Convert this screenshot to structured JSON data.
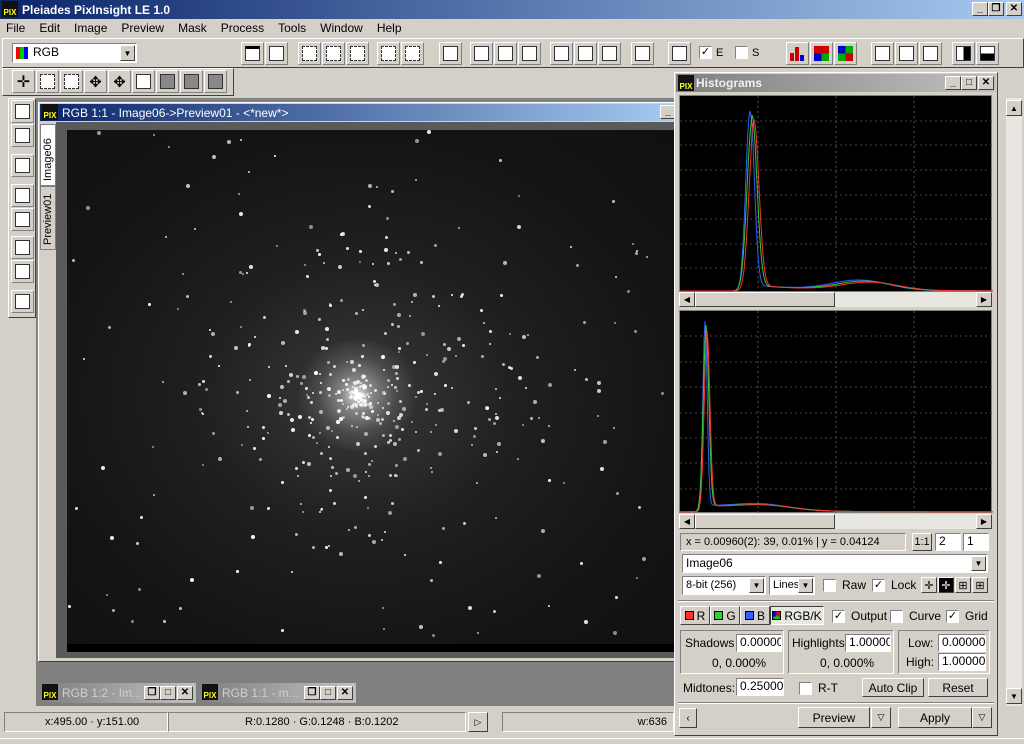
{
  "app": {
    "title": "Pleiades PixInsight LE 1.0",
    "logo_text": "PIX"
  },
  "menu": [
    "File",
    "Edit",
    "Image",
    "Preview",
    "Mask",
    "Process",
    "Tools",
    "Window",
    "Help"
  ],
  "toolbar": {
    "colorspace": "RGB",
    "check_e_label": "E",
    "check_s_label": "S"
  },
  "image_window": {
    "title": "RGB 1:1 - Image06->Preview01 - <*new*>",
    "tabs": [
      "Image06",
      "Preview01"
    ]
  },
  "minimized": [
    {
      "label": "RGB 1:2 - Im..."
    },
    {
      "label": "RGB 1:1 - m..."
    }
  ],
  "histograms": {
    "title": "Histograms",
    "readout": "x = 0.00960(2): 39, 0.01% | y = 0.04124",
    "zoom_btn": "1:1",
    "zoom_x": "2",
    "zoom_y": "1",
    "image_select": "Image06",
    "resolution": "8-bit (256)",
    "mode": "Lines",
    "raw_label": "Raw",
    "lock_label": "Lock",
    "channels": {
      "r": "R",
      "g": "G",
      "b": "B",
      "rgbk": "RGB/K"
    },
    "output_label": "Output",
    "curve_label": "Curve",
    "grid_label": "Grid",
    "shadows_label": "Shadows",
    "shadows_value": "0.00000",
    "shadows_stats": "0,  0.000%",
    "highlights_label": "Highlights",
    "highlights_value": "1.00000",
    "highlights_stats": "0,  0.000%",
    "low_label": "Low:",
    "low_value": "0.00000",
    "high_label": "High:",
    "high_value": "1.00000",
    "midtones_label": "Midtones:",
    "midtones_value": "0.25000",
    "rt_label": "R-T",
    "autoclip_label": "Auto Clip",
    "reset_label": "Reset",
    "preview_label": "Preview",
    "apply_label": "Apply",
    "colors": {
      "red": "#ff3030",
      "green": "#30d030",
      "blue": "#3060ff",
      "bg": "#000000"
    }
  },
  "status": {
    "coords": "x:495.00 · y:151.00",
    "rgb": "R:0.1280 · G:0.1248 · B:0.1202",
    "width": "w:636"
  }
}
